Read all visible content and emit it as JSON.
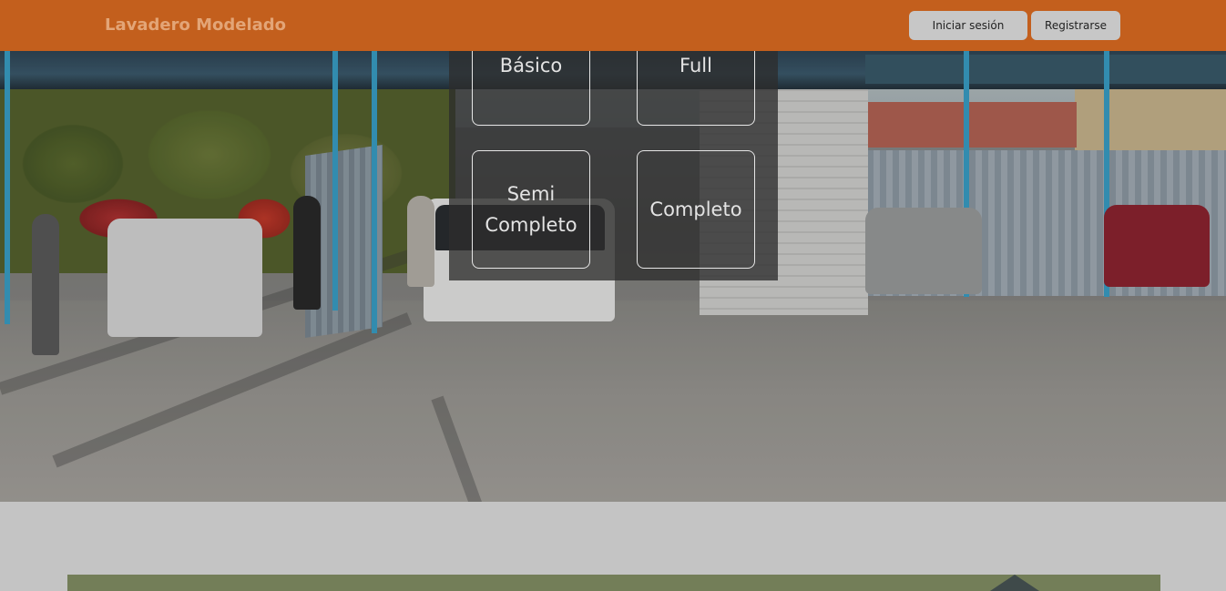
{
  "header": {
    "brand": "Lavadero Modelado",
    "login_label": "Iniciar sesión",
    "register_label": "Registrarse"
  },
  "services": [
    {
      "label": "Básico"
    },
    {
      "label": "Full"
    },
    {
      "label": "Semi Completo"
    },
    {
      "label": "Completo"
    }
  ],
  "colors": {
    "navbar": "#c35f1d",
    "brand_text": "#e3a577",
    "button_bg": "#c7c7c7",
    "panel_bg": "#2d2d2d",
    "page_bg": "#c4c4c4",
    "banner": "#737e58"
  }
}
